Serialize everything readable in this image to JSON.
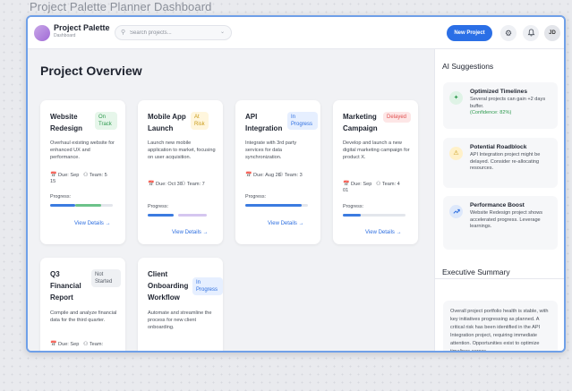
{
  "caption": "Project Palette Planner Dashboard",
  "header": {
    "brand_title": "Project Palette",
    "brand_subtitle": "Dashboard",
    "search_placeholder": "Search projects...",
    "new_project_label": "New Project",
    "avatar_initials": "JD"
  },
  "main": {
    "title": "Project Overview",
    "progress_label": "Progress:",
    "view_details_label": "View Details →",
    "cards": [
      {
        "title": "Website Redesign",
        "status": "On Track",
        "status_color": "#2e9a4e",
        "description": "Overhaul existing website for enhanced UX and performance.",
        "due": "Due: Sep 15",
        "team": "Team: 5",
        "progress": 0.82
      },
      {
        "title": "Mobile App Launch",
        "status": "At Risk",
        "status_color": "#c89a16",
        "description": "Launch new mobile application to market, focusing on user acquisition.",
        "due": "Due: Oct 30",
        "team": "Team: 7",
        "progress": 0.45
      },
      {
        "title": "API Integration",
        "status": "In Progress",
        "status_color": "#2e6fe0",
        "description": "Integrate with 3rd party services for data synchronization.",
        "due": "Due: Aug 28",
        "team": "Team: 3",
        "progress": 0.9
      },
      {
        "title": "Marketing Campaign",
        "status": "Delayed",
        "status_color": "#e05050",
        "description": "Develop and launch a new digital marketing campaign for product X.",
        "due": "Due: Sep 01",
        "team": "Team: 4",
        "progress": 0.28
      },
      {
        "title": "Q3 Financial Report",
        "status": "Not Started",
        "status_color": "#5a606a",
        "description": "Compile and analyze financial data for the third quarter.",
        "due": "Due: Sep",
        "team": "Team:"
      },
      {
        "title": "Client Onboarding Workflow",
        "status": "In Progress",
        "status_color": "#2e6fe0",
        "description": "Automate and streamline the process for new client onboarding."
      }
    ]
  },
  "side": {
    "ai_title": "AI Suggestions",
    "suggestions": [
      {
        "icon": "sparkle-icon",
        "title": "Optimized Timelines",
        "text": "Several projects can gain +2 days buffer.",
        "highlight": "(Confidence: 82%)"
      },
      {
        "icon": "warning-icon",
        "title": "Potential Roadblock",
        "text": "API Integration project might be delayed. Consider re-allocating resources."
      },
      {
        "icon": "trend-up-icon",
        "title": "Performance Boost",
        "text": "Website Redesign project shows accelerated progress. Leverage learnings."
      }
    ],
    "summary_title": "Executive Summary",
    "summary_text": "Overall project portfolio health is stable, with key initiatives progressing as planned. A critical risk has been identified in the API Integration project, requiring immediate attention. Opportunities exist to optimize timelines across"
  },
  "colors": {
    "accent": "#2b6fe6",
    "window_border": "#6fa0e8"
  }
}
